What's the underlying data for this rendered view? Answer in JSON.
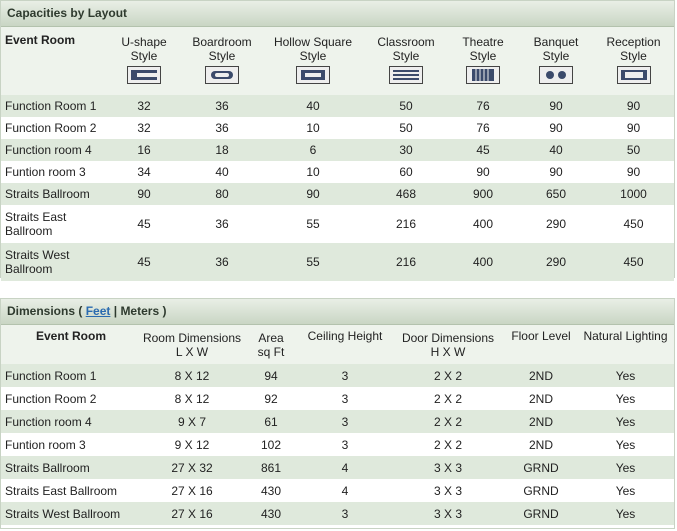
{
  "capacities": {
    "title": "Capacities by Layout",
    "columns": [
      {
        "label": "Event Room",
        "sub": ""
      },
      {
        "label": "U-shape",
        "sub": "Style",
        "icon": "u-shape-layout-icon"
      },
      {
        "label": "Boardroom",
        "sub": "Style",
        "icon": "boardroom-layout-icon"
      },
      {
        "label": "Hollow Square",
        "sub": "Style",
        "icon": "hollow-square-layout-icon"
      },
      {
        "label": "Classroom",
        "sub": "Style",
        "icon": "classroom-layout-icon"
      },
      {
        "label": "Theatre",
        "sub": "Style",
        "icon": "theatre-layout-icon"
      },
      {
        "label": "Banquet",
        "sub": "Style",
        "icon": "banquet-layout-icon"
      },
      {
        "label": "Reception",
        "sub": "Style",
        "icon": "reception-layout-icon"
      }
    ],
    "rows": [
      {
        "room": "Function Room 1",
        "values": [
          "32",
          "36",
          "40",
          "50",
          "76",
          "90",
          "90"
        ]
      },
      {
        "room": "Function Room 2",
        "values": [
          "32",
          "36",
          "10",
          "50",
          "76",
          "90",
          "90"
        ]
      },
      {
        "room": "Function room 4",
        "values": [
          "16",
          "18",
          "6",
          "30",
          "45",
          "40",
          "50"
        ]
      },
      {
        "room": "Funtion room 3",
        "values": [
          "34",
          "40",
          "10",
          "60",
          "90",
          "90",
          "90"
        ]
      },
      {
        "room": "Straits Ballroom",
        "values": [
          "90",
          "80",
          "90",
          "468",
          "900",
          "650",
          "1000"
        ]
      },
      {
        "room": "Straits East Ballroom",
        "values": [
          "45",
          "36",
          "55",
          "216",
          "400",
          "290",
          "450"
        ]
      },
      {
        "room": "Straits West Ballroom",
        "values": [
          "45",
          "36",
          "55",
          "216",
          "400",
          "290",
          "450"
        ]
      }
    ]
  },
  "dimensions": {
    "title": "Dimensions",
    "open_paren": "(",
    "unit_feet": "Feet",
    "separator": "|",
    "unit_meters": "Meters",
    "close_paren": ")",
    "columns": [
      {
        "label": "Event Room",
        "sub": ""
      },
      {
        "label": "Room Dimensions",
        "sub": "L X W"
      },
      {
        "label": "Area",
        "sub": "sq Ft"
      },
      {
        "label": "Ceiling Height",
        "sub": ""
      },
      {
        "label": "Door Dimensions",
        "sub": "H X W"
      },
      {
        "label": "Floor Level",
        "sub": ""
      },
      {
        "label": "Natural Lighting",
        "sub": ""
      }
    ],
    "rows": [
      {
        "room": "Function Room 1",
        "values": [
          "8 X 12",
          "94",
          "3",
          "2 X 2",
          "2ND",
          "Yes"
        ]
      },
      {
        "room": "Function Room 2",
        "values": [
          "8 X 12",
          "92",
          "3",
          "2 X 2",
          "2ND",
          "Yes"
        ]
      },
      {
        "room": "Function room 4",
        "values": [
          "9 X 7",
          "61",
          "3",
          "2 X 2",
          "2ND",
          "Yes"
        ]
      },
      {
        "room": "Funtion room 3",
        "values": [
          "9 X 12",
          "102",
          "3",
          "2 X 2",
          "2ND",
          "Yes"
        ]
      },
      {
        "room": "Straits Ballroom",
        "values": [
          "27 X 32",
          "861",
          "4",
          "3 X 3",
          "GRND",
          "Yes"
        ]
      },
      {
        "room": "Straits East Ballroom",
        "values": [
          "27 X 16",
          "430",
          "4",
          "3 X 3",
          "GRND",
          "Yes"
        ]
      },
      {
        "room": "Straits West Ballroom",
        "values": [
          "27 X 16",
          "430",
          "3",
          "3 X 3",
          "GRND",
          "Yes"
        ]
      }
    ]
  },
  "colors": {
    "header_green": "#c9d6c4",
    "row_alt": "#dfe9dc",
    "link_blue": "#2a6bb0"
  }
}
